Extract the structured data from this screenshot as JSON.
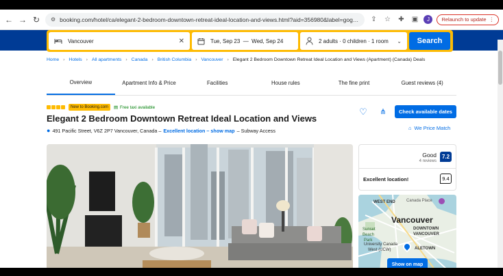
{
  "browser": {
    "url": "booking.com/hotel/ca/elegant-2-bedroom-downtown-retreat-ideal-location-and-views.html?aid=356980&label=gog235jc-10CAsoJ0I7ZWxlZ2...",
    "relaunch_label": "Relaunch to update",
    "avatar_letter": "J"
  },
  "search": {
    "destination": "Vancouver",
    "dates": "Tue, Sep 23  —  Wed, Sep 24",
    "guests": "2 adults · 0 children · 1 room",
    "search_label": "Search"
  },
  "breadcrumb": [
    "Home",
    "Hotels",
    "All apartments",
    "Canada",
    "British Columbia",
    "Vancouver",
    "Elegant 2 Bedroom Downtown Retreat Ideal Location and Views (Apartment) (Canada) Deals"
  ],
  "tabs": [
    "Overview",
    "Apartment Info & Price",
    "Facilities",
    "House rules",
    "The fine print",
    "Guest reviews (4)"
  ],
  "property": {
    "new_badge": "New to Booking.com",
    "taxi_badge": "Free taxi available",
    "title": "Elegant 2 Bedroom Downtown Retreat Ideal Location and Views",
    "address": "491 Pacific Street, V6Z 2P7 Vancouver, Canada –",
    "excellent_location": "Excellent location – show map",
    "subway": "– Subway Access",
    "check_dates_label": "Check available dates",
    "price_match_label": "We Price Match"
  },
  "reviews": {
    "rating_word": "Good",
    "count": "4 reviews",
    "score": "7.2",
    "location_label": "Excellent location!",
    "location_score": "9.4"
  },
  "map": {
    "labels": [
      "WEST END",
      "Canada Place",
      "Vancouver",
      "DOWNTOWN",
      "VANCOUVER",
      "Sunset",
      "Beach",
      "Park",
      "University Canada",
      "West (UCW)",
      "ALETOWN"
    ],
    "show_map_label": "Show on map"
  },
  "colors": {
    "brand_blue": "#003b95",
    "accent_blue": "#006ce4",
    "search_yellow": "#febb02"
  }
}
